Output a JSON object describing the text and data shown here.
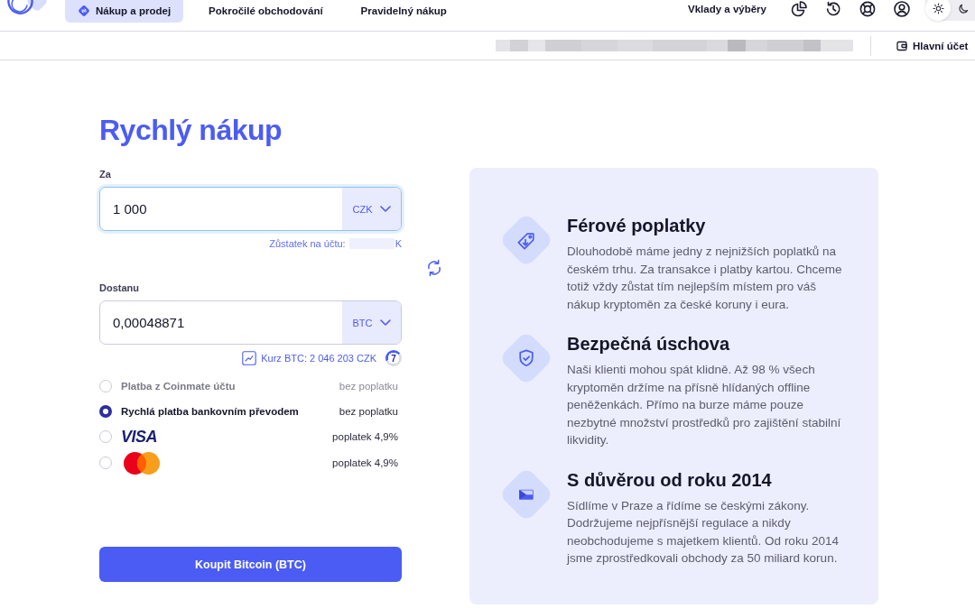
{
  "header": {
    "nav": [
      {
        "label": "Nákup a prodej",
        "selected": true
      },
      {
        "label": "Pokročilé obchodování",
        "selected": false
      },
      {
        "label": "Pravidelný nákup",
        "selected": false
      }
    ],
    "deposits_link": "Vklady a výběry",
    "theme_toggle": [
      {
        "kind": "light",
        "selected": true
      },
      {
        "kind": "dark",
        "selected": false
      }
    ]
  },
  "account_bar": {
    "account": "Hlavní účet"
  },
  "title": "Rychlý nákup",
  "pay": {
    "label": "Za",
    "value": "1 000",
    "currency": "CZK",
    "focused": true,
    "balance_label": "Zůstatek na účtu:",
    "balance_suffix": "K"
  },
  "receive": {
    "label": "Dostanu",
    "value": "0,00048871",
    "currency": "BTC",
    "focused": false
  },
  "rate": {
    "text": "Kurz BTC: 2 046 203 CZK",
    "countdown": "7",
    "level": 0.45
  },
  "payment_methods": [
    {
      "kind": "text",
      "label": "Platba z Coinmate účtu",
      "fee": "bez poplatku",
      "selected": false,
      "disabled": true
    },
    {
      "kind": "text",
      "label": "Rychlá platba bankovním převodem",
      "fee": "bez poplatku",
      "selected": true,
      "disabled": false
    },
    {
      "kind": "visa",
      "label": "VISA",
      "fee": "poplatek 4,9%",
      "selected": false,
      "disabled": false
    },
    {
      "kind": "mastercard",
      "fee": "poplatek 4,9%",
      "selected": false,
      "disabled": false
    }
  ],
  "submit": "Koupit Bitcoin (BTC)",
  "features": [
    {
      "kind": "tag",
      "title": "Férové poplatky",
      "text": "Dlouhodobě máme jedny z nejnižších poplatků na českém trhu. Za transakce i platby kartou. Chceme totiž vždy zůstat tím nejlepším místem pro váš nákup kryptoměn za české koruny i eura."
    },
    {
      "kind": "shield",
      "title": "Bezpečná úschova",
      "text": "Naši klienti mohou spát klidně. Až 98 % všech kryptoměn držíme na přísně hlídaných offline peněženkách. Přímo na burze máme pouze nezbytné množství prostředků pro zajištění stabilní likvidity."
    },
    {
      "kind": "flag",
      "title": "S důvěrou od roku 2014",
      "text": "Sídlíme v Praze a řídíme se českými zákony. Dodržujeme nejpřísnější regulace a nikdy neobchodujeme s majetkem klientů. Od roku 2014 jsme zprostředkovali obchody za 50 miliard korun."
    }
  ]
}
